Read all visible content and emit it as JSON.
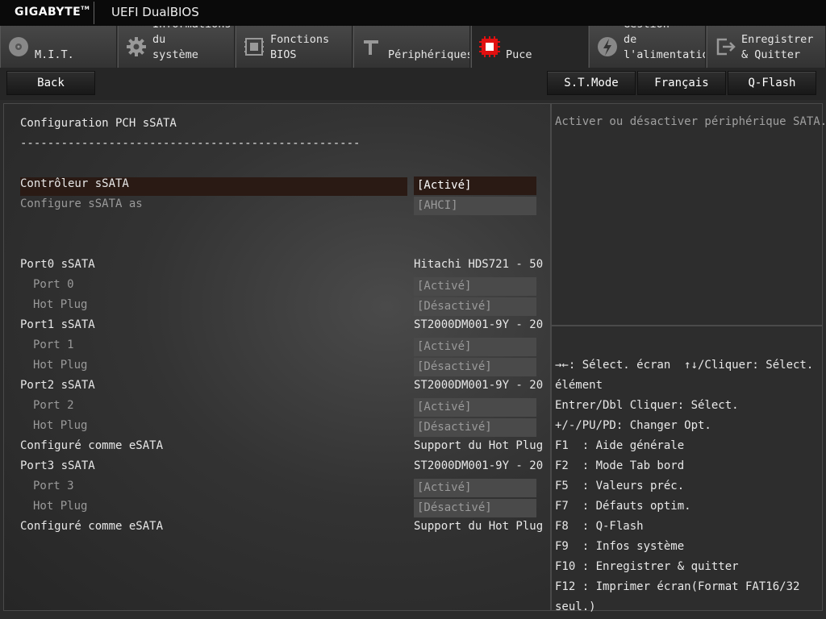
{
  "titlebar": {
    "brand": "GIGABYTE",
    "brand_tm": "TM",
    "bios_name": "UEFI DualBIOS"
  },
  "tabs": [
    {
      "label": "M.I.T.",
      "icon": "disc-icon"
    },
    {
      "label": "Informations\ndu\nsystème",
      "icon": "gear-icon"
    },
    {
      "label": "Fonctions\nBIOS",
      "icon": "bios-chip-icon"
    },
    {
      "label": "Périphériques",
      "icon": "connector-icon"
    },
    {
      "label": "Puce",
      "icon": "chip-icon",
      "active": true
    },
    {
      "label": "Gestion\nde\nl'alimentation",
      "icon": "power-icon"
    },
    {
      "label": "Enregistrer\n& Quitter",
      "icon": "exit-icon"
    }
  ],
  "actions": {
    "back": "Back",
    "stmode": "S.T.Mode",
    "language": "Français",
    "qflash": "Q-Flash"
  },
  "main": {
    "heading": "Configuration PCH sSATA",
    "separator": "--------------------------------------------------",
    "rows": [
      {
        "label": "Contrôleur sSATA",
        "value": "[Activé]"
      },
      {
        "label": "Configure sSATA as",
        "value": "[AHCI]"
      },
      {
        "label": "Port0 sSATA",
        "value": "Hitachi HDS721 - 50"
      },
      {
        "label": "Port 0",
        "value": "[Activé]"
      },
      {
        "label": "Hot Plug",
        "value": "[Désactivé]"
      },
      {
        "label": "Port1 sSATA",
        "value": "ST2000DM001-9Y - 20"
      },
      {
        "label": "Port 1",
        "value": "[Activé]"
      },
      {
        "label": "Hot Plug",
        "value": "[Désactivé]"
      },
      {
        "label": "Port2 sSATA",
        "value": "ST2000DM001-9Y - 20"
      },
      {
        "label": "Port 2",
        "value": "[Activé]"
      },
      {
        "label": "Hot Plug",
        "value": "[Désactivé]"
      },
      {
        "label": "Configuré comme eSATA",
        "value": "Support du Hot Plug"
      },
      {
        "label": "Port3 sSATA",
        "value": "ST2000DM001-9Y - 20"
      },
      {
        "label": "Port 3",
        "value": "[Activé]"
      },
      {
        "label": "Hot Plug",
        "value": "[Désactivé]"
      },
      {
        "label": "Configuré comme eSATA",
        "value": "Support du Hot Plug"
      }
    ]
  },
  "help": {
    "text": "Activer ou désactiver périphérique SATA."
  },
  "keys": {
    "text": "→←: Sélect. écran  ↑↓/Cliquer: Sélect. élément\nEntrer/Dbl Cliquer: Sélect.\n+/-/PU/PD: Changer Opt.\nF1  : Aide générale\nF2  : Mode Tab bord\nF5  : Valeurs préc.\nF7  : Défauts optim.\nF8  : Q-Flash\nF9  : Infos système\nF10 : Enregistrer & quitter\nF12 : Imprimer écran(Format FAT16/32 seul.)"
  },
  "colors": {
    "accent_red": "#e01010",
    "selected_row": "#2a1a14",
    "background": "#2b2b2b"
  }
}
